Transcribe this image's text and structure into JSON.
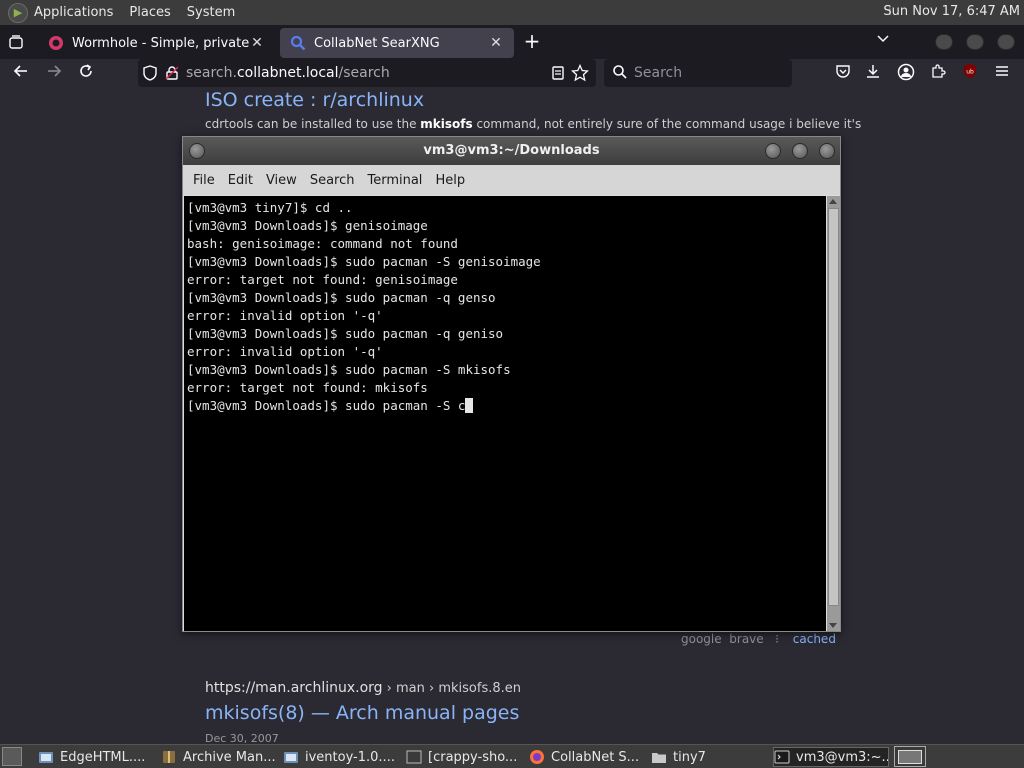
{
  "top_panel": {
    "menus": [
      "Applications",
      "Places",
      "System"
    ],
    "clock": "Sun Nov 17,  6:47 AM"
  },
  "browser": {
    "tabs": [
      {
        "title": "Wormhole - Simple, private file",
        "active": false
      },
      {
        "title": "CollabNet SearXNG",
        "active": true
      }
    ],
    "url": {
      "scheme": "search.",
      "host": "collabnet.local",
      "path": "/search"
    },
    "search_placeholder": "Search"
  },
  "page": {
    "result1": {
      "title": "ISO create : r/archlinux",
      "snippet_pre": "cdrtools can be installed to use the ",
      "snippet_bold": "mkisofs",
      "snippet_post": " command, not entirely sure of the command usage i believe it's"
    },
    "engines": [
      "google",
      "brave"
    ],
    "cached_label": "cached",
    "result2": {
      "url_base": "https://man.archlinux.org",
      "url_crumbs": " › man › mkisofs.8.en",
      "title": "mkisofs(8) — Arch manual pages",
      "date": "Dec 30, 2007"
    }
  },
  "terminal": {
    "title": "vm3@vm3:~/Downloads",
    "menu": [
      "File",
      "Edit",
      "View",
      "Search",
      "Terminal",
      "Help"
    ],
    "lines": [
      "[vm3@vm3 tiny7]$ cd ..",
      "[vm3@vm3 Downloads]$ genisoimage",
      "bash: genisoimage: command not found",
      "[vm3@vm3 Downloads]$ sudo pacman -S genisoimage",
      "error: target not found: genisoimage",
      "[vm3@vm3 Downloads]$ sudo pacman -q genso",
      "error: invalid option '-q'",
      "[vm3@vm3 Downloads]$ sudo pacman -q geniso",
      "error: invalid option '-q'",
      "[vm3@vm3 Downloads]$ sudo pacman -S mkisofs",
      "error: target not found: mkisofs"
    ],
    "current_line": "[vm3@vm3 Downloads]$ sudo pacman -S c"
  },
  "taskbar": {
    "tasks": [
      {
        "label": "EdgeHTML....",
        "icon": "file-browser-icon"
      },
      {
        "label": "Archive Man...",
        "icon": "archive-icon"
      },
      {
        "label": "iventoy-1.0....",
        "icon": "file-browser-icon"
      },
      {
        "label": "[crappy-sho...",
        "icon": "image-viewer-icon"
      },
      {
        "label": "CollabNet S...",
        "icon": "firefox-icon"
      },
      {
        "label": "tiny7",
        "icon": "folder-icon"
      },
      {
        "label": "vm3@vm3:~...",
        "icon": "terminal-icon",
        "active": true
      }
    ]
  },
  "colors": {
    "link": "#8ab4f8",
    "browser_bg": "#2b2a33",
    "terminal_bg": "#000000"
  }
}
